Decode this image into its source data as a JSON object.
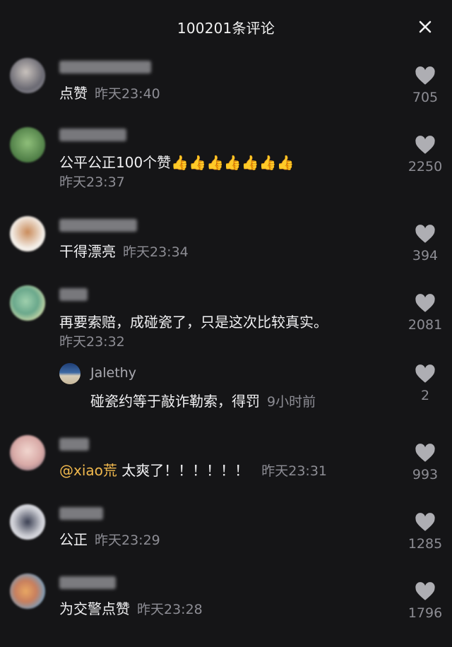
{
  "header": {
    "title": "100201条评论",
    "close_label": "×"
  },
  "comments": [
    {
      "text": "点赞",
      "time": "昨天23:40",
      "likes": "705"
    },
    {
      "text": "公平公正100个赞👍👍👍👍👍👍👍",
      "time": "昨天23:37",
      "likes": "2250"
    },
    {
      "text": "干得漂亮",
      "time": "昨天23:34",
      "likes": "394"
    },
    {
      "text": "再要索赔，成碰瓷了，只是这次比较真实。",
      "time": "昨天23:32",
      "likes": "2081"
    },
    {
      "mention": "@xiao荒",
      "text": " 太爽了！！！！！！",
      "time": "昨天23:31",
      "likes": "993"
    },
    {
      "text": "公正",
      "time": "昨天23:29",
      "likes": "1285"
    },
    {
      "text": "为交警点赞",
      "time": "昨天23:28",
      "likes": "1796"
    }
  ],
  "reply": {
    "user": "Jalethy",
    "text": "碰瓷约等于敲诈勒索，得罚",
    "time": "9小时前",
    "likes": "2"
  },
  "colors": {
    "background": "#151517",
    "mention": "#f0b84d",
    "meta": "#8d8d94"
  }
}
